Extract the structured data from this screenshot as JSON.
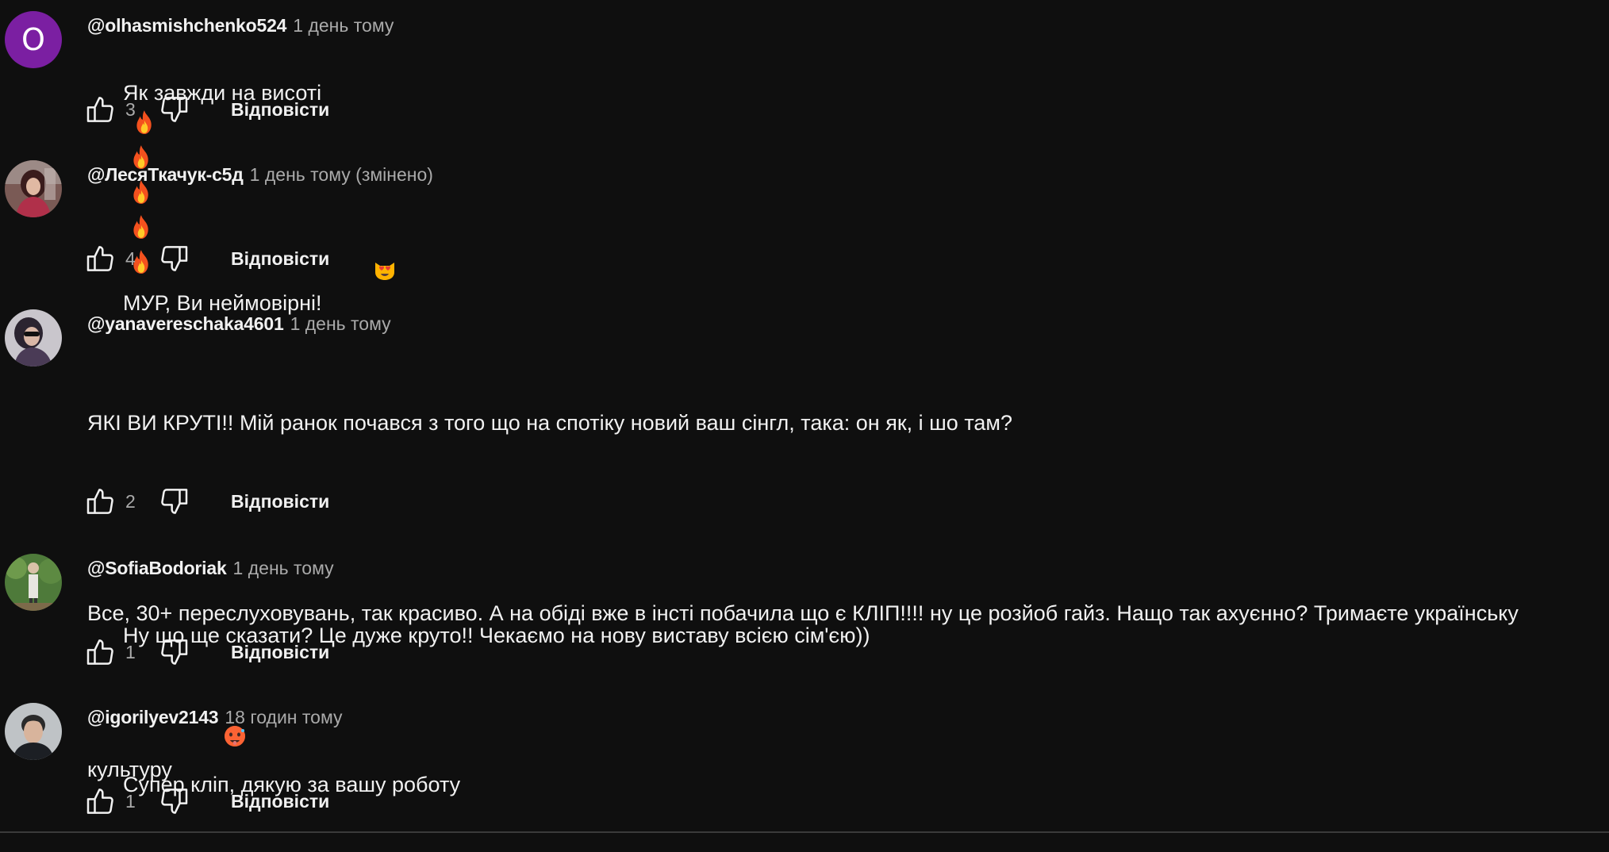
{
  "comments": [
    {
      "author": "@olhasmishchenko524",
      "time": "1 день тому",
      "text": "Як завжди на висоті",
      "emojis": [
        "fire-emoji",
        "fire-emoji",
        "fire-emoji",
        "fire-emoji",
        "fire-emoji"
      ],
      "likes": "3",
      "reply_label": "Відповісти",
      "avatar": {
        "type": "letter",
        "letter": "O",
        "color": "#7b1fa2"
      }
    },
    {
      "author": "@ЛесяТкачук-с5д",
      "time": "1 день тому (змінено)",
      "text": "МУР, Ви неймовірні!",
      "emojis": [
        "heart-eyes-cat-emoji"
      ],
      "likes": "4",
      "reply_label": "Відповісти",
      "avatar": {
        "type": "photo",
        "icon": "woman-portrait-avatar"
      }
    },
    {
      "author": "@yanavereschaka4601",
      "time": "1 день тому",
      "text_line1": "ЯКІ ВИ КРУТІ!! Мій ранок почався з того що на спотіку новий ваш сінгл, така: он як, і шо там?",
      "text_line2": "Все, 30+ переслуховувань, так красиво. А на обіді вже в інсті побачила що є КЛІП!!!! ну це розйоб гайз. Нащо так ахуєнно? Тримаєте українську",
      "text_line3": "культуру",
      "emojis": [
        "hot-face-emoji"
      ],
      "likes": "2",
      "reply_label": "Відповісти",
      "avatar": {
        "type": "photo",
        "icon": "woman-sunglasses-avatar"
      }
    },
    {
      "author": "@SofiaBodoriak",
      "time": "1 день тому",
      "text": "Ну що ще сказати? Це дуже круто!! Чекаємо на нову виставу всією сім'єю))",
      "likes": "1",
      "reply_label": "Відповісти",
      "avatar": {
        "type": "photo",
        "icon": "person-in-garden-avatar"
      }
    },
    {
      "author": "@igorilyev2143",
      "time": "18 годин тому",
      "text": "Супер кліп, дякую за вашу роботу",
      "likes": "1",
      "reply_label": "Відповісти",
      "avatar": {
        "type": "photo",
        "icon": "man-portrait-avatar"
      }
    }
  ],
  "colors": {
    "background": "#0f0f0f",
    "text_primary": "#f1f1f1",
    "text_secondary": "#aaaaaa"
  }
}
